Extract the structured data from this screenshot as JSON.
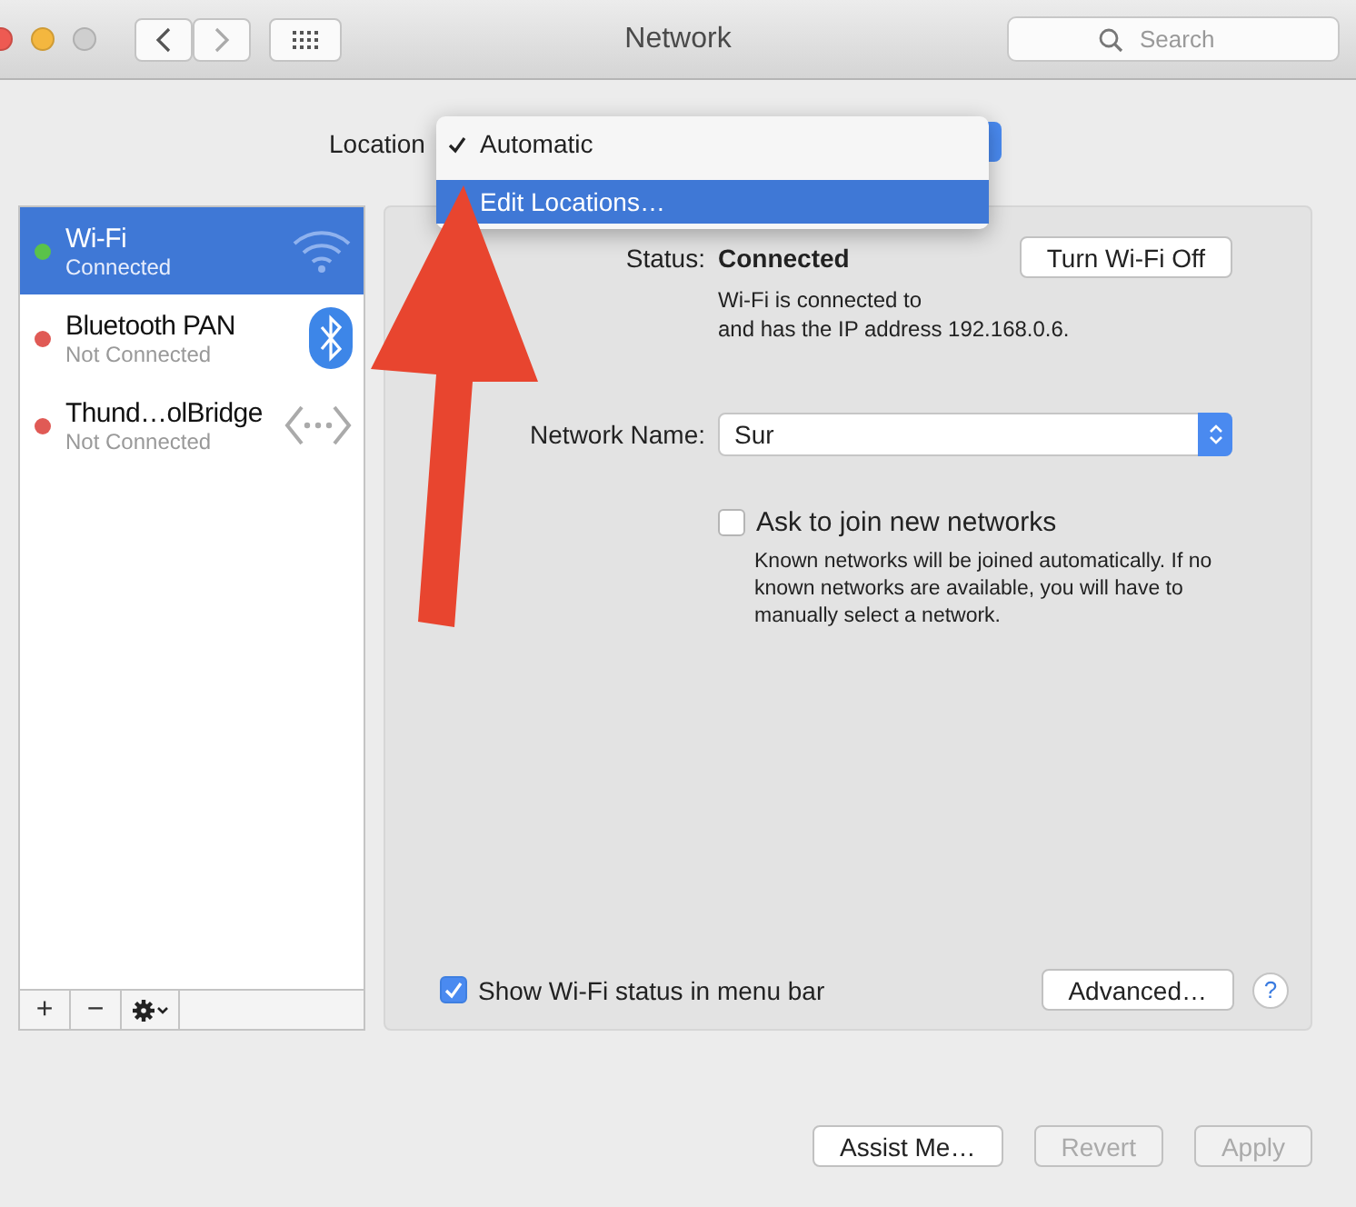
{
  "window": {
    "title": "Network"
  },
  "search": {
    "placeholder": "Search"
  },
  "location": {
    "label": "Location",
    "menu": [
      {
        "label": "Automatic",
        "checked": true,
        "selected": false
      },
      {
        "label": "Edit Locations…",
        "checked": false,
        "selected": true
      }
    ]
  },
  "services": [
    {
      "name": "Wi-Fi",
      "status": "Connected",
      "color": "#5ac24a",
      "selected": true,
      "kind": "wifi"
    },
    {
      "name": "Bluetooth PAN",
      "status": "Not Connected",
      "color": "#e05a55",
      "selected": false,
      "kind": "bluetooth"
    },
    {
      "name": "Thund…olBridge",
      "status": "Not Connected",
      "color": "#e05a55",
      "selected": false,
      "kind": "ethernet"
    }
  ],
  "sidebar_toolbar": [
    "+",
    "−"
  ],
  "detail": {
    "status_label": "Status:",
    "status_value": "Connected",
    "toggle_button": "Turn Wi-Fi Off",
    "status_text": [
      "Wi-Fi is connected to",
      "and has the IP address 192.168.0.6."
    ],
    "network_label": "Network Name:",
    "network_value": "Sur",
    "ask": {
      "label": "Ask to join new networks",
      "checked": false
    },
    "ask_help": "Known networks will be joined automatically. If no known networks are available, you will have to manually select a network.",
    "show_status": {
      "label": "Show Wi-Fi status in menu bar",
      "checked": true
    },
    "advanced_button": "Advanced…",
    "help_button": "?"
  },
  "buttons": [
    {
      "label": "Assist Me…",
      "disabled": false
    },
    {
      "label": "Revert",
      "disabled": true
    },
    {
      "label": "Apply",
      "disabled": true
    }
  ]
}
